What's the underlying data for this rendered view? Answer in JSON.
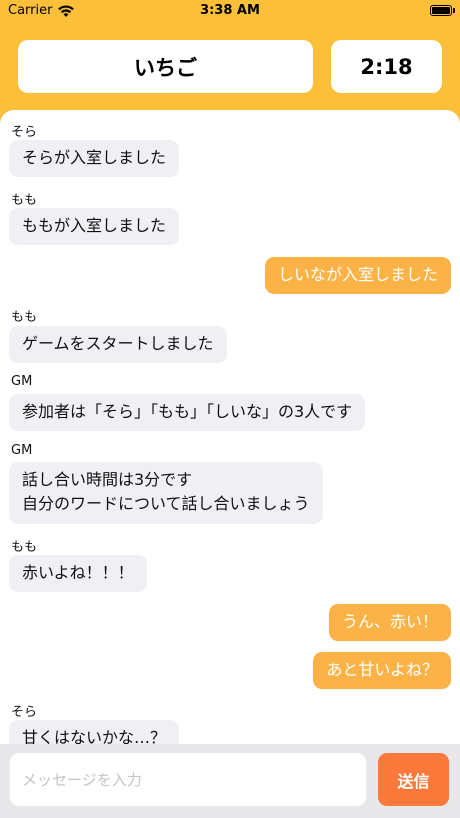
{
  "status_bar": {
    "carrier": "Carrier",
    "time": "3:38 AM"
  },
  "header": {
    "title": "いちご",
    "timer": "2:18"
  },
  "messages": [
    {
      "sender": "そら",
      "text": "そらが入室しました",
      "side": "left"
    },
    {
      "sender": "もも",
      "text": "ももが入室しました",
      "side": "left"
    },
    {
      "sender": "",
      "text": "しいなが入室しました",
      "side": "right"
    },
    {
      "sender": "もも",
      "text": "ゲームをスタートしました",
      "side": "left"
    },
    {
      "sender": "GM",
      "text": "参加者は「そら」「もも」「しいな」の3人です",
      "side": "left"
    },
    {
      "sender": "GM",
      "lines": [
        "話し合い時間は3分です",
        "自分のワードについて話し合いましょう"
      ],
      "side": "left"
    },
    {
      "sender": "もも",
      "text": "赤いよね！！！",
      "side": "left"
    },
    {
      "sender": "",
      "text": "うん、赤い！",
      "side": "right"
    },
    {
      "sender": "",
      "text": "あと甘いよね？",
      "side": "right"
    },
    {
      "sender": "そら",
      "text": "甘くはないかな…？",
      "side": "left"
    }
  ],
  "input": {
    "placeholder": "メッセージを入力",
    "value": ""
  },
  "send_label": "送信",
  "colors": {
    "header_background": "#fbbf3a",
    "my_bubble": "#fbb347",
    "other_bubble": "#f0f0f4",
    "send_button": "#fb7a3b"
  }
}
